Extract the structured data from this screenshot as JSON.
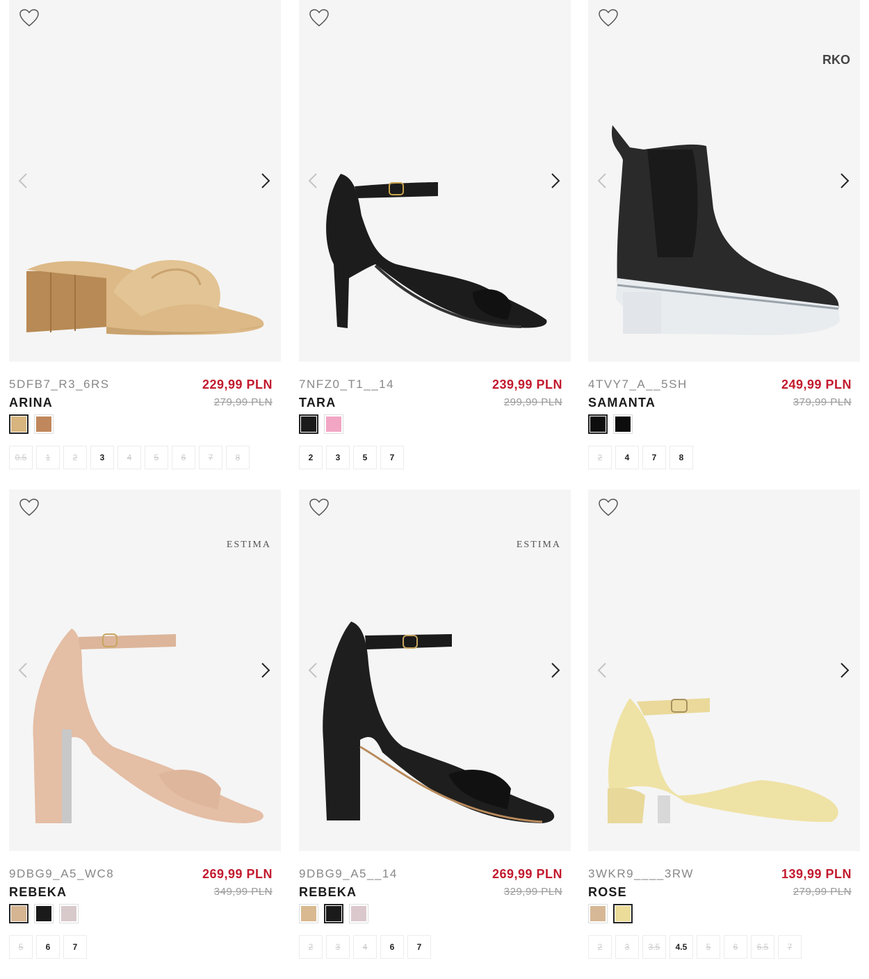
{
  "colors": {
    "price": "#c21a2e",
    "image_bg": "#f5f5f5"
  },
  "products": [
    {
      "code": "5DFB7_R3_6RS",
      "name": "ARINA",
      "price": "229,99 PLN",
      "old_price": "279,99 PLN",
      "brand": "",
      "swatches": [
        {
          "color": "#d8b57f",
          "selected": true
        },
        {
          "color": "#c0875c",
          "selected": false
        }
      ],
      "sizes": [
        {
          "label": "0.5",
          "available": false
        },
        {
          "label": "1",
          "available": false
        },
        {
          "label": "2",
          "available": false
        },
        {
          "label": "3",
          "available": true
        },
        {
          "label": "4",
          "available": false
        },
        {
          "label": "5",
          "available": false
        },
        {
          "label": "6",
          "available": false
        },
        {
          "label": "7",
          "available": false
        },
        {
          "label": "8",
          "available": false
        }
      ]
    },
    {
      "code": "7NFZ0_T1__14",
      "name": "TARA",
      "price": "239,99 PLN",
      "old_price": "299,99 PLN",
      "brand": "",
      "swatches": [
        {
          "color": "#1a1a1a",
          "selected": true
        },
        {
          "color": "#f2a6c4",
          "selected": false
        }
      ],
      "sizes": [
        {
          "label": "2",
          "available": true
        },
        {
          "label": "3",
          "available": true
        },
        {
          "label": "5",
          "available": true
        },
        {
          "label": "7",
          "available": true
        }
      ]
    },
    {
      "code": "4TVY7_A__5SH",
      "name": "SAMANTA",
      "price": "249,99 PLN",
      "old_price": "379,99 PLN",
      "brand": "RKO",
      "swatches": [
        {
          "color": "#0d0d0d",
          "selected": true
        },
        {
          "color": "#0d0d0d",
          "selected": false
        }
      ],
      "sizes": [
        {
          "label": "2",
          "available": false
        },
        {
          "label": "4",
          "available": true
        },
        {
          "label": "7",
          "available": true
        },
        {
          "label": "8",
          "available": true
        }
      ]
    },
    {
      "code": "9DBG9_A5_WC8",
      "name": "REBEKA",
      "price": "269,99 PLN",
      "old_price": "349,99 PLN",
      "brand": "ESTIMA",
      "swatches": [
        {
          "color": "#d5b592",
          "selected": true
        },
        {
          "color": "#1a1a1a",
          "selected": false
        },
        {
          "color": "#d8c9cb",
          "selected": false
        }
      ],
      "sizes": [
        {
          "label": "5",
          "available": false
        },
        {
          "label": "6",
          "available": true
        },
        {
          "label": "7",
          "available": true
        }
      ]
    },
    {
      "code": "9DBG9_A5__14",
      "name": "REBEKA",
      "price": "269,99 PLN",
      "old_price": "329,99 PLN",
      "brand": "ESTIMA",
      "swatches": [
        {
          "color": "#d9b990",
          "selected": false
        },
        {
          "color": "#1a1a1a",
          "selected": true
        },
        {
          "color": "#dbc8cc",
          "selected": false
        }
      ],
      "sizes": [
        {
          "label": "2",
          "available": false
        },
        {
          "label": "3",
          "available": false
        },
        {
          "label": "4",
          "available": false
        },
        {
          "label": "6",
          "available": true
        },
        {
          "label": "7",
          "available": true
        }
      ]
    },
    {
      "code": "3WKR9____3RW",
      "name": "ROSE",
      "price": "139,99 PLN",
      "old_price": "279,99 PLN",
      "brand": "",
      "swatches": [
        {
          "color": "#d6b896",
          "selected": false
        },
        {
          "color": "#ecdc9a",
          "selected": true
        }
      ],
      "sizes": [
        {
          "label": "2",
          "available": false
        },
        {
          "label": "3",
          "available": false
        },
        {
          "label": "3.5",
          "available": false
        },
        {
          "label": "4.5",
          "available": true
        },
        {
          "label": "5",
          "available": false
        },
        {
          "label": "6",
          "available": false
        },
        {
          "label": "6.5",
          "available": false
        },
        {
          "label": "7",
          "available": false
        }
      ]
    }
  ]
}
